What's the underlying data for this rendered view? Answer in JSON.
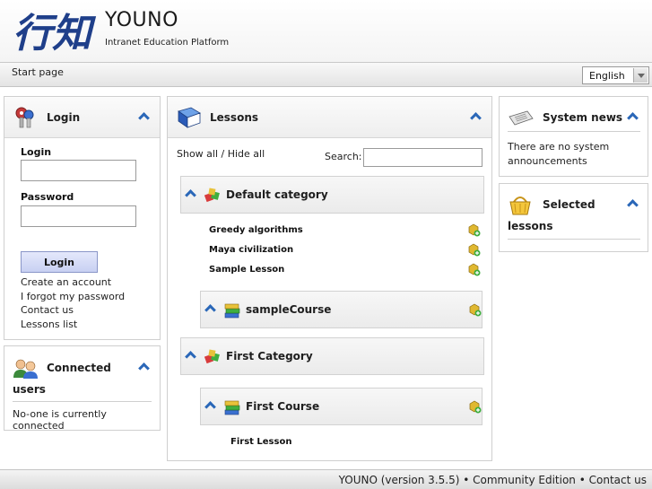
{
  "header": {
    "title": "YOUNO",
    "subtitle": "Intranet Education Platform",
    "logo_text": "行知"
  },
  "nav": {
    "breadcrumb": "Start page",
    "language": "English"
  },
  "login_panel": {
    "title": "Login",
    "login_label": "Login",
    "login_value": "",
    "password_label": "Password",
    "password_value": "",
    "button": "Login",
    "links": [
      "Create an account",
      "I forgot my password",
      "Contact us",
      "Lessons list"
    ]
  },
  "connected_panel": {
    "title_line1": "Connected",
    "title_line2": "users",
    "message": "No-one is currently connected"
  },
  "lessons_panel": {
    "title": "Lessons",
    "toggle": "Show all / Hide all",
    "search_label": "Search:",
    "search_value": "",
    "categories": [
      {
        "name": "Default category",
        "lessons": [
          "Greedy algorithms",
          "Maya civilization",
          "Sample Lesson"
        ],
        "courses": [
          {
            "name": "sampleCourse"
          }
        ]
      },
      {
        "name": "First Category",
        "courses": [
          {
            "name": "First Course",
            "lessons": [
              "First Lesson"
            ]
          }
        ]
      }
    ]
  },
  "news_panel": {
    "title": "System news",
    "message": "There are no system announcements"
  },
  "selected_panel": {
    "title_line1": "Selected",
    "title_line2": "lessons"
  },
  "footer": {
    "product": "YOUNO (version 3.5.5)",
    "sep": " • ",
    "edition": "Community Edition",
    "contact": "Contact us"
  },
  "colors": {
    "accent": "#2a67b8",
    "logo": "#1f3f8a"
  },
  "icons": {
    "login": "keys-icon",
    "connected": "users-icon",
    "lessons": "book-icon",
    "news": "newspaper-icon",
    "selected": "basket-icon",
    "category": "blocks-icon",
    "course": "books-stack-icon",
    "add": "add-lesson-icon"
  }
}
